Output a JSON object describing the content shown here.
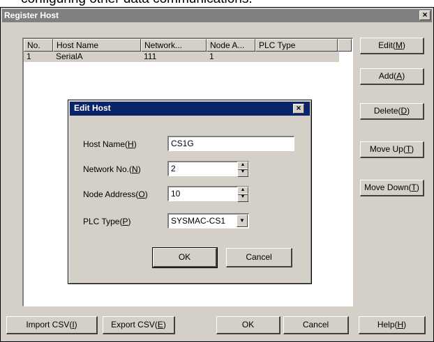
{
  "caption_fragment": "configuring other data communications.",
  "window": {
    "title": "Register Host",
    "close_glyph": "×",
    "list": {
      "columns": [
        "No.",
        "Host Name",
        "Network...",
        "Node A...",
        "PLC Type",
        ""
      ],
      "rows": [
        {
          "no": "1",
          "host_name": "SerialA",
          "network": "111",
          "node": "1",
          "plc_type": ""
        }
      ]
    },
    "side_buttons": {
      "edit": {
        "text": "Edit(",
        "key": "M",
        "end": ")"
      },
      "add": {
        "text": "Add(",
        "key": "A",
        "end": ")"
      },
      "delete": {
        "text": "Delete(",
        "key": "D",
        "end": ")"
      },
      "move_up": {
        "text": "Move Up(",
        "key": "T",
        "end": ")"
      },
      "move_down": {
        "text": "Move Down(",
        "key": "T",
        "end": ")"
      }
    },
    "bottom_buttons": {
      "import_csv": {
        "text": "Import CSV(",
        "key": "I",
        "end": ")"
      },
      "export_csv": {
        "text": "Export CSV(",
        "key": "E",
        "end": ")"
      },
      "ok": "OK",
      "cancel": "Cancel",
      "help": {
        "text": "Help(",
        "key": "H",
        "end": ")"
      }
    }
  },
  "edit_dialog": {
    "title": "Edit Host",
    "close_glyph": "×",
    "host_name": {
      "label": "Host Name(",
      "key": "H",
      "end": ")",
      "value": "CS1G"
    },
    "network_no": {
      "label": "Network No.(",
      "key": "N",
      "end": ")",
      "value": "2"
    },
    "node_address": {
      "label": "Node Address(",
      "key": "O",
      "end": ")",
      "value": "10"
    },
    "plc_type": {
      "label": "PLC Type(",
      "key": "P",
      "end": ")",
      "value": "SYSMAC-CS1"
    },
    "ok": "OK",
    "cancel": "Cancel",
    "spin_up_glyph": "▲",
    "spin_down_glyph": "▼",
    "combo_glyph": "▼"
  },
  "colors": {
    "face": "#d4d0c8",
    "active_title": "#0a246a",
    "inactive_title": "#808080"
  }
}
